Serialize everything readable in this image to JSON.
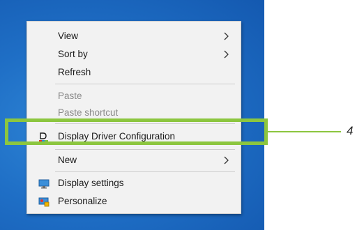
{
  "menu": {
    "view": "View",
    "sort_by": "Sort by",
    "refresh": "Refresh",
    "paste": "Paste",
    "paste_shortcut": "Paste shortcut",
    "display_driver_configuration": "Display Driver Configuration",
    "new": "New",
    "display_settings": "Display settings",
    "personalize": "Personalize"
  },
  "icons": {
    "display_driver": "display-driver-config-icon",
    "display_settings": "monitor-icon",
    "personalize": "personalize-icon",
    "submenu": "chevron-right-icon"
  },
  "callout": {
    "number": "4"
  },
  "colors": {
    "highlight": "#8cc63f",
    "desktop": "#1f6fc6",
    "menu_bg": "#f2f2f2",
    "disabled_text": "#8a8a8a"
  }
}
